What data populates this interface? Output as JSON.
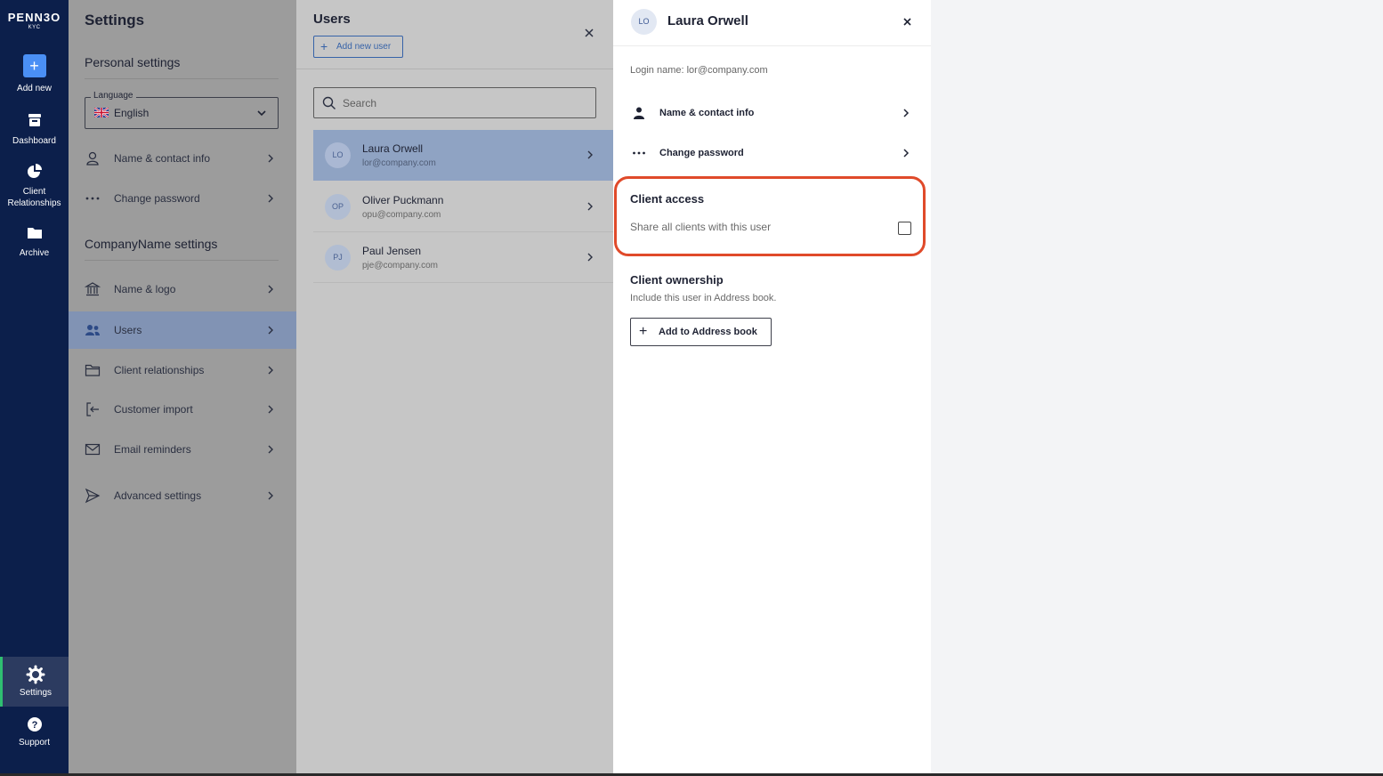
{
  "nav": {
    "logo_main": "PENN3O",
    "logo_sub": "KYC",
    "items": [
      {
        "label": "Add new",
        "icon": "plus-icon"
      },
      {
        "label": "Dashboard",
        "icon": "inbox-icon"
      },
      {
        "label": "Client Relationships",
        "icon": "pie-chart-icon"
      },
      {
        "label": "Archive",
        "icon": "folder-icon"
      }
    ],
    "bottom_items": [
      {
        "label": "Settings",
        "icon": "gear-icon",
        "active": true
      },
      {
        "label": "Support",
        "icon": "question-icon"
      }
    ]
  },
  "settings": {
    "title": "Settings",
    "personal_heading": "Personal settings",
    "language_legend": "Language",
    "language_value": "English",
    "personal_items": [
      {
        "label": "Name & contact info",
        "icon": "user-icon"
      },
      {
        "label": "Change password",
        "icon": "dots-icon"
      }
    ],
    "company_heading": "CompanyName settings",
    "company_items": [
      {
        "label": "Name & logo",
        "icon": "bank-icon"
      },
      {
        "label": "Users",
        "icon": "users-icon",
        "active": true
      },
      {
        "label": "Client relationships",
        "icon": "folder-icon"
      },
      {
        "label": "Customer import",
        "icon": "import-icon"
      },
      {
        "label": "Email reminders",
        "icon": "envelope-icon"
      },
      {
        "label": "Advanced settings",
        "icon": "send-icon"
      }
    ]
  },
  "users": {
    "title": "Users",
    "add_label": "Add new user",
    "search_placeholder": "Search",
    "list": [
      {
        "initials": "LO",
        "name": "Laura Orwell",
        "email": "lor@company.com",
        "active": true
      },
      {
        "initials": "OP",
        "name": "Oliver Puckmann",
        "email": "opu@company.com"
      },
      {
        "initials": "PJ",
        "name": "Paul Jensen",
        "email": "pje@company.com"
      }
    ]
  },
  "detail": {
    "initials": "LO",
    "name": "Laura Orwell",
    "login": "Login name: lor@company.com",
    "rows": [
      {
        "label": "Name & contact info",
        "icon": "person-icon"
      },
      {
        "label": "Change password",
        "icon": "dots-icon"
      }
    ],
    "client_access_title": "Client access",
    "client_access_text": "Share all clients with this user",
    "client_access_checked": false,
    "client_ownership_title": "Client ownership",
    "client_ownership_text": "Include this user in Address book.",
    "add_book_label": "Add to Address book"
  },
  "colors": {
    "nav_bg": "#0c1f4b",
    "accent": "#4a8ff5",
    "active_row": "#8193b4",
    "highlight": "#e04a2a",
    "settings_active_bar": "#2fbf71"
  }
}
